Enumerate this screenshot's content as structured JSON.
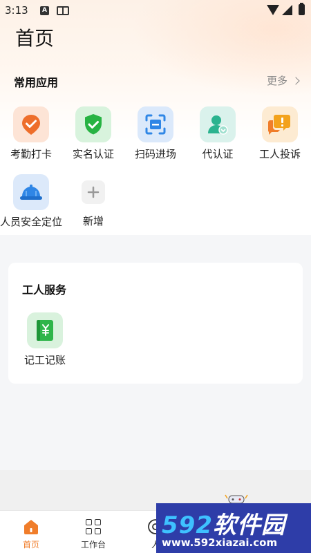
{
  "status_bar": {
    "time": "3:13",
    "notif_letter": "A"
  },
  "header": {
    "title": "首页"
  },
  "common_apps": {
    "title": "常用应用",
    "more_label": "更多",
    "items": [
      {
        "label": "考勤打卡",
        "icon": "attendance-check-icon"
      },
      {
        "label": "实名认证",
        "icon": "shield-check-icon"
      },
      {
        "label": "扫码进场",
        "icon": "scan-icon"
      },
      {
        "label": "代认证",
        "icon": "user-verify-icon"
      },
      {
        "label": "工人投诉",
        "icon": "complaint-icon"
      },
      {
        "label": "人员安全定位",
        "icon": "helmet-icon"
      },
      {
        "label": "新增",
        "icon": "plus-icon"
      }
    ]
  },
  "worker_service": {
    "title": "工人服务",
    "items": [
      {
        "label": "记工记账",
        "icon": "ledger-yen-icon"
      }
    ]
  },
  "tabbar": {
    "items": [
      {
        "label": "首页",
        "active": true
      },
      {
        "label": "工作台",
        "active": false
      },
      {
        "label": "人",
        "active": false
      }
    ]
  },
  "watermark": {
    "brand_num": "592",
    "brand_text": "软件园",
    "url": "www.592xiazai.com"
  },
  "colors": {
    "accent": "#f07d2a",
    "green": "#27b343",
    "blue": "#2f86e6"
  }
}
